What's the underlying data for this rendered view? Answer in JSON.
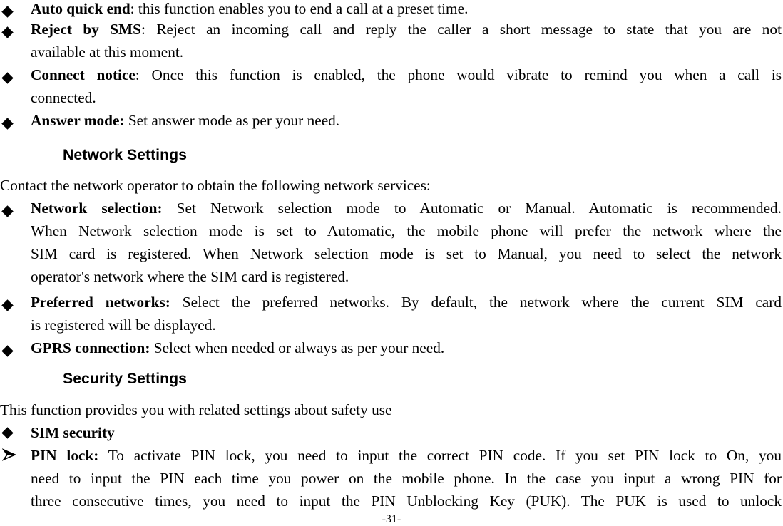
{
  "items_top": [
    {
      "term": "Auto quick end",
      "sep": ":",
      "lines": [
        " this function enables you to end a call at a preset time."
      ]
    },
    {
      "term": "Reject by SMS",
      "sep": ":",
      "lines": [
        " Reject an incoming call and reply the caller a short message to state that you are not",
        "available at this moment."
      ]
    },
    {
      "term": "Connect notice",
      "sep": ":",
      "lines": [
        " Once this function is enabled, the phone would vibrate to remind you when a call is",
        "connected."
      ]
    },
    {
      "term": "Answer mode:",
      "sep": "",
      "lines": [
        " Set answer mode as per your need."
      ]
    }
  ],
  "network": {
    "heading": "Network Settings",
    "intro": "Contact the network operator to obtain the following network services:",
    "items": [
      {
        "term": "Network selection:",
        "lines": [
          " Set Network selection mode to Automatic or Manual. Automatic is recommended.",
          "When Network selection mode is set to Automatic, the mobile phone will prefer the network where the",
          "SIM card is registered. When Network selection mode is set to Manual, you need to select the network",
          "operator's network where the SIM card is registered."
        ]
      },
      {
        "term": "Preferred networks:",
        "lines": [
          " Select the preferred networks. By default, the network where the current SIM card",
          "is registered will be displayed."
        ]
      },
      {
        "term": "GPRS connection:",
        "lines": [
          " Select when needed or always as per your need."
        ]
      }
    ]
  },
  "security": {
    "heading": "Security Settings",
    "intro": "This function provides you with related settings about safety use",
    "sim_security": "SIM security",
    "pin_lock": {
      "term": "PIN lock:",
      "lines": [
        " To activate PIN lock, you need to input the correct PIN code. If you set PIN lock to On, you",
        "need to input the PIN each time you power on the mobile phone. In the case you input a wrong PIN for",
        "three consecutive times, you need to input the PIN Unblocking Key (PUK). The PUK is used to unlock"
      ]
    }
  },
  "page_number": "-31-"
}
